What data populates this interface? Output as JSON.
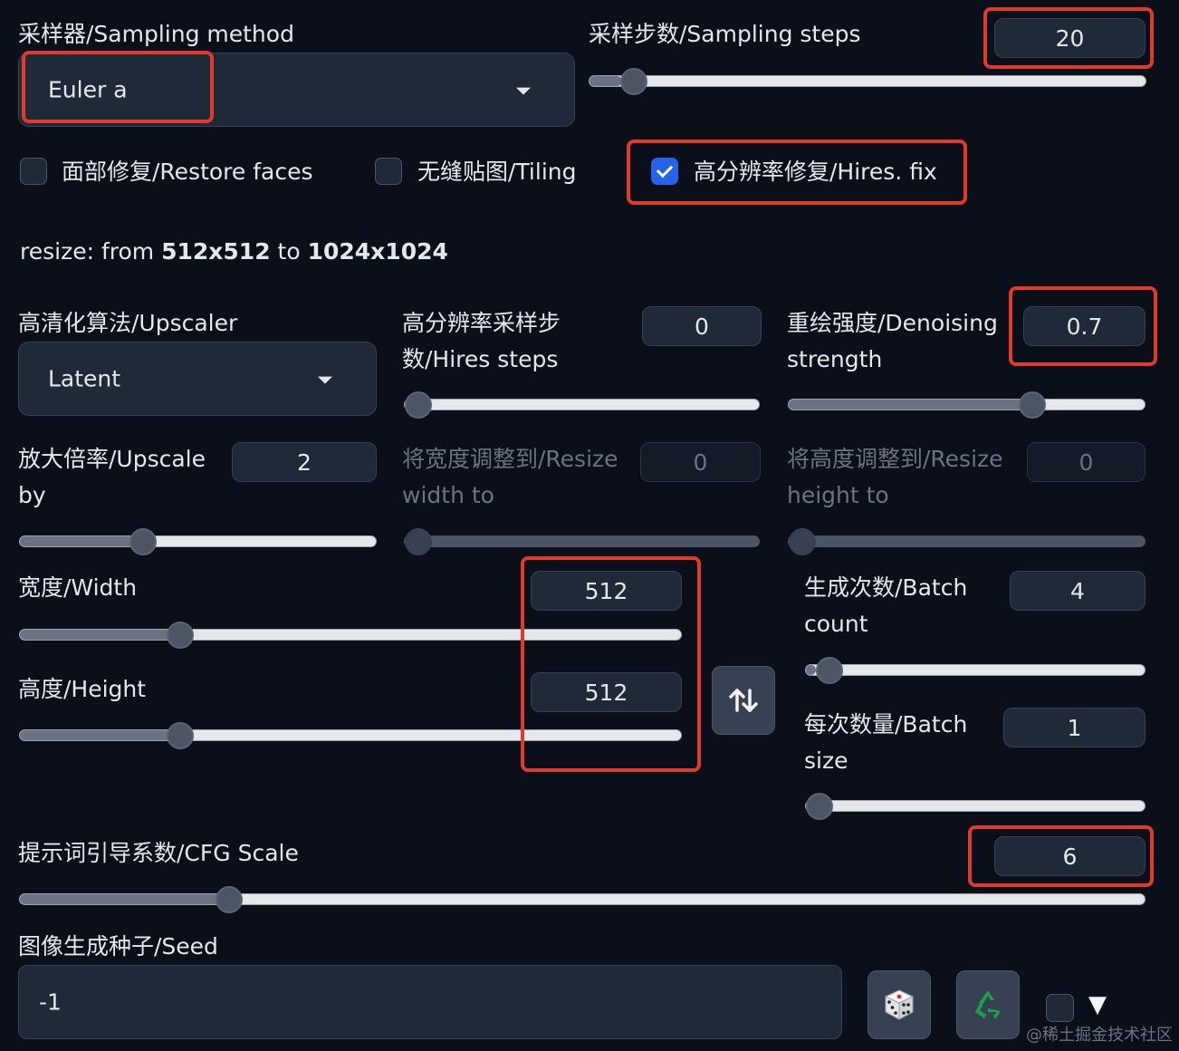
{
  "sampler": {
    "label": "采样器/Sampling method",
    "value": "Euler a"
  },
  "steps": {
    "label": "采样步数/Sampling steps",
    "value": "20",
    "slider_fraction": 0.059
  },
  "checkboxes": {
    "restore_faces": {
      "label": "面部修复/Restore faces",
      "checked": false
    },
    "tiling": {
      "label": "无缝贴图/Tiling",
      "checked": false
    },
    "hires_fix": {
      "label": "高分辨率修复/Hires. fix",
      "checked": true
    }
  },
  "resize_info": {
    "prefix": "resize: from ",
    "from": "512x512",
    "middle": " to ",
    "to": "1024x1024"
  },
  "upscaler": {
    "label": "高清化算法/Upscaler",
    "value": "Latent"
  },
  "hires_steps": {
    "label": "高分辨率采样步数/Hires steps",
    "value": "0",
    "slider_fraction": 0.0
  },
  "denoising": {
    "label": "重绘强度/Denoising strength",
    "value": "0.7",
    "slider_fraction": 0.7
  },
  "upscale_by": {
    "label": "放大倍率/Upscale by",
    "value": "2",
    "slider_fraction": 0.3333
  },
  "resize_width": {
    "label": "将宽度调整到/Resize width to",
    "value": "0",
    "slider_fraction": 0.0
  },
  "resize_height": {
    "label": "将高度调整到/Resize height to",
    "value": "0",
    "slider_fraction": 0.0
  },
  "width": {
    "label": "宽度/Width",
    "value": "512",
    "slider_fraction": 0.2308
  },
  "height": {
    "label": "高度/Height",
    "value": "512",
    "slider_fraction": 0.2308
  },
  "batch_count": {
    "label": "生成次数/Batch count",
    "value": "4",
    "slider_fraction": 0.0306
  },
  "batch_size": {
    "label": "每次数量/Batch size",
    "value": "1",
    "slider_fraction": 0.0
  },
  "cfg_scale": {
    "label": "提示词引导系数/CFG Scale",
    "value": "6",
    "slider_fraction": 0.1786
  },
  "seed": {
    "label": "图像生成种子/Seed",
    "value": "-1",
    "extra_toggle": "▼"
  },
  "watermark": "@稀土掘金技术社区",
  "colors": {
    "accent": "#2563eb",
    "highlight": "#e03a2c",
    "background": "#0b0f19"
  },
  "icons": {
    "swap": "swap-vertical-icon",
    "dice": "dice-icon",
    "recycle": "recycle-icon"
  }
}
